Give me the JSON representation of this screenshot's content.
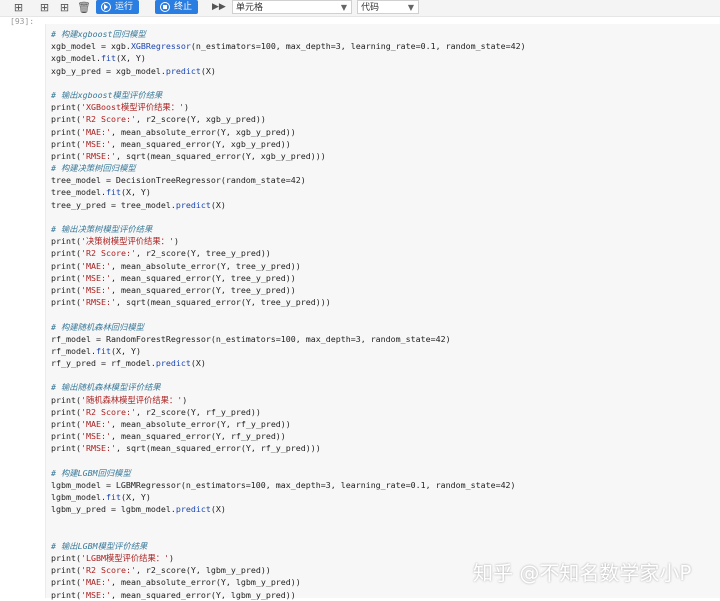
{
  "toolbar": {
    "run_label": "运行",
    "stop_label": "终止",
    "cell_type": "单元格",
    "cell_mode": "代码",
    "colors": {
      "button": "#2a7de1"
    }
  },
  "cell": {
    "prompt": "[93]:",
    "lines": [
      {
        "kind": "cm",
        "text": "# 构建xgboost回归模型"
      },
      {
        "kind": "code",
        "text": "xgb_model = xgb.XGBRegressor(n_estimators=100, max_depth=3, learning_rate=0.1, random_state=42)"
      },
      {
        "kind": "code",
        "text": "xgb_model.fit(X, Y)"
      },
      {
        "kind": "code",
        "text": "xgb_y_pred = xgb_model.predict(X)"
      },
      {
        "kind": "blank",
        "text": ""
      },
      {
        "kind": "cm",
        "text": "# 输出xgboost模型评价结果"
      },
      {
        "kind": "code",
        "text": "print('XGBoost模型评价结果：')"
      },
      {
        "kind": "code",
        "text": "print('R2 Score:', r2_score(Y, xgb_y_pred))"
      },
      {
        "kind": "code",
        "text": "print('MAE:', mean_absolute_error(Y, xgb_y_pred))"
      },
      {
        "kind": "code",
        "text": "print('MSE:', mean_squared_error(Y, xgb_y_pred))"
      },
      {
        "kind": "code",
        "text": "print('RMSE:', sqrt(mean_squared_error(Y, xgb_y_pred)))"
      },
      {
        "kind": "cm",
        "text": "# 构建决策树回归模型"
      },
      {
        "kind": "code",
        "text": "tree_model = DecisionTreeRegressor(random_state=42)"
      },
      {
        "kind": "code",
        "text": "tree_model.fit(X, Y)"
      },
      {
        "kind": "code",
        "text": "tree_y_pred = tree_model.predict(X)"
      },
      {
        "kind": "blank",
        "text": ""
      },
      {
        "kind": "cm",
        "text": "# 输出决策树模型评价结果"
      },
      {
        "kind": "code",
        "text": "print('决策树模型评价结果：')"
      },
      {
        "kind": "code",
        "text": "print('R2 Score:', r2_score(Y, tree_y_pred))"
      },
      {
        "kind": "code",
        "text": "print('MAE:', mean_absolute_error(Y, tree_y_pred))"
      },
      {
        "kind": "code",
        "text": "print('MSE:', mean_squared_error(Y, tree_y_pred))"
      },
      {
        "kind": "code",
        "text": "print('MSE:', mean_squared_error(Y, tree_y_pred))"
      },
      {
        "kind": "code",
        "text": "print('RMSE:', sqrt(mean_squared_error(Y, tree_y_pred)))"
      },
      {
        "kind": "blank",
        "text": ""
      },
      {
        "kind": "cm",
        "text": "# 构建随机森林回归模型"
      },
      {
        "kind": "code",
        "text": "rf_model = RandomForestRegressor(n_estimators=100, max_depth=3, random_state=42)"
      },
      {
        "kind": "code",
        "text": "rf_model.fit(X, Y)"
      },
      {
        "kind": "code",
        "text": "rf_y_pred = rf_model.predict(X)"
      },
      {
        "kind": "blank",
        "text": ""
      },
      {
        "kind": "cm",
        "text": "# 输出随机森林模型评价结果"
      },
      {
        "kind": "code",
        "text": "print('随机森林模型评价结果：')"
      },
      {
        "kind": "code",
        "text": "print('R2 Score:', r2_score(Y, rf_y_pred))"
      },
      {
        "kind": "code",
        "text": "print('MAE:', mean_absolute_error(Y, rf_y_pred))"
      },
      {
        "kind": "code",
        "text": "print('MSE:', mean_squared_error(Y, rf_y_pred))"
      },
      {
        "kind": "code",
        "text": "print('RMSE:', sqrt(mean_squared_error(Y, rf_y_pred)))"
      },
      {
        "kind": "blank",
        "text": ""
      },
      {
        "kind": "cm",
        "text": "# 构建LGBM回归模型"
      },
      {
        "kind": "code",
        "text": "lgbm_model = LGBMRegressor(n_estimators=100, max_depth=3, learning_rate=0.1, random_state=42)"
      },
      {
        "kind": "code",
        "text": "lgbm_model.fit(X, Y)"
      },
      {
        "kind": "code",
        "text": "lgbm_y_pred = lgbm_model.predict(X)"
      },
      {
        "kind": "blank",
        "text": ""
      },
      {
        "kind": "blank",
        "text": ""
      },
      {
        "kind": "cm",
        "text": "# 输出LGBM模型评价结果"
      },
      {
        "kind": "code",
        "text": "print('LGBM模型评价结果：')"
      },
      {
        "kind": "code",
        "text": "print('R2 Score:', r2_score(Y, lgbm_y_pred))"
      },
      {
        "kind": "code",
        "text": "print('MAE:', mean_absolute_error(Y, lgbm_y_pred))"
      },
      {
        "kind": "code",
        "text": "print('MSE:', mean_squared_error(Y, lgbm_y_pred))"
      }
    ]
  },
  "watermark": "知乎 @不知名数学家小P"
}
